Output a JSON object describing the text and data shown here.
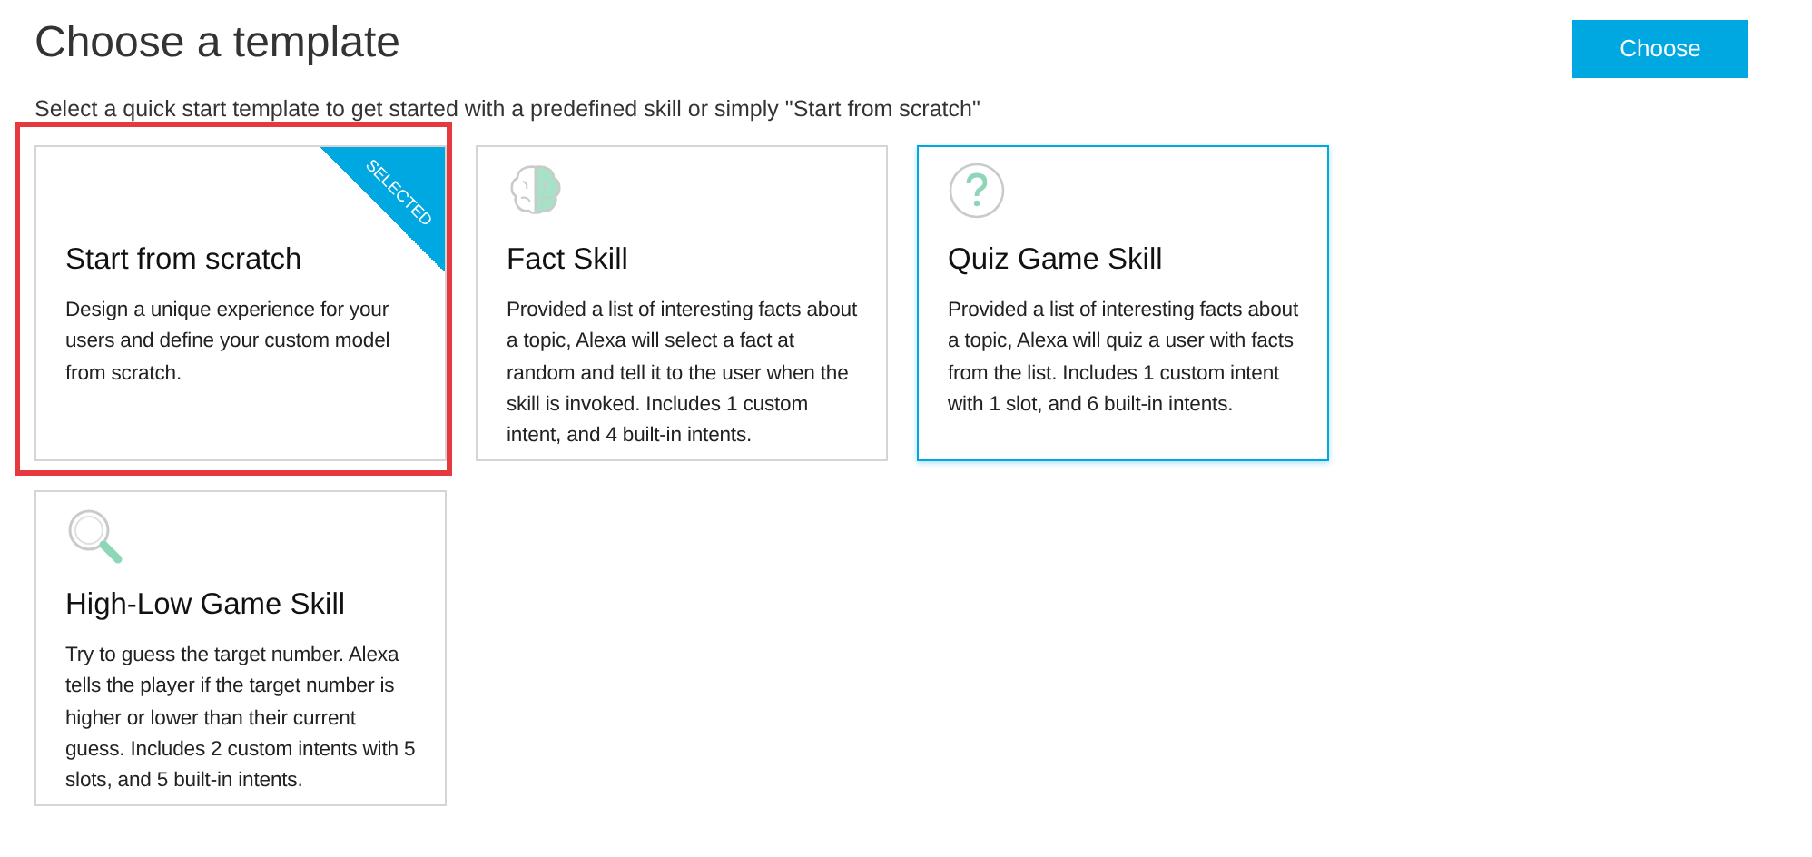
{
  "header": {
    "title": "Choose a template",
    "button": "Choose"
  },
  "subtitle": "Select a quick start template to get started with a predefined skill or simply \"Start from scratch\"",
  "templates": [
    {
      "name": "Start from scratch",
      "description": "Design a unique experience for your users and define your custom model from scratch.",
      "kind": "blank",
      "selected": true,
      "focused": false,
      "annotated": true,
      "badge": "SELECTED"
    },
    {
      "name": "Fact Skill",
      "description": "Provided a list of interesting facts about a topic, Alexa will select a fact at random and tell it to the user when the skill is invoked. Includes 1 custom intent, and 4 built-in intents.",
      "kind": "brain",
      "selected": false,
      "focused": false,
      "annotated": false
    },
    {
      "name": "Quiz Game Skill",
      "description": "Provided a list of interesting facts about a topic, Alexa will quiz a user with facts from the list. Includes 1 custom intent with 1 slot, and 6 built-in intents.",
      "kind": "question",
      "selected": false,
      "focused": true,
      "annotated": false
    },
    {
      "name": "High-Low Game Skill",
      "description": "Try to guess the target number. Alexa tells the player if the target number is higher or lower than their current guess. Includes 2 custom intents with 5 slots, and 5 built-in intents.",
      "kind": "magnifier",
      "selected": false,
      "focused": false,
      "annotated": false
    }
  ]
}
